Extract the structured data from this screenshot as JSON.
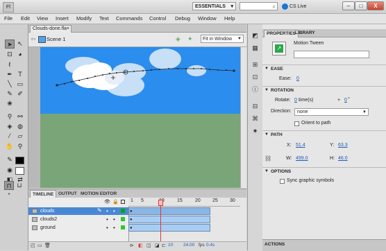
{
  "app": {
    "logo": "Fl"
  },
  "titlebar": {
    "workspace": "ESSENTIALS",
    "cs_live": "CS Live",
    "min": "–",
    "max": "□",
    "close": "X"
  },
  "menu": [
    "File",
    "Edit",
    "View",
    "Insert",
    "Modify",
    "Text",
    "Commands",
    "Control",
    "Debug",
    "Window",
    "Help"
  ],
  "document": {
    "tab": "Clouds-done.fla",
    "close": "×",
    "scene": "Scene 1",
    "zoom": "Fit in Window"
  },
  "timeline": {
    "tabs": [
      "TIMELINE",
      "OUTPUT",
      "MOTION EDITOR"
    ],
    "layers": [
      {
        "name": "clouds",
        "selected": true,
        "color": "#00aa00"
      },
      {
        "name": "clouds2",
        "selected": false,
        "color": "#2ec72e"
      },
      {
        "name": "ground",
        "selected": false,
        "color": "#2ec72e"
      }
    ],
    "ruler": [
      "1",
      "5",
      "10",
      "15",
      "20",
      "25",
      "30"
    ],
    "current_frame": "10",
    "fps": "24.00",
    "fps_unit": "fps",
    "time": "0.4s"
  },
  "properties": {
    "tabs": [
      "PROPERTIES",
      "LIBRARY"
    ],
    "type": "Motion Tween",
    "ease_section": "EASE",
    "ease_label": "Ease:",
    "ease_value": "0",
    "rotation_section": "ROTATION",
    "rotate_label": "Rotate:",
    "rotate_times": "0",
    "rotate_times_unit": "time(s)",
    "rotate_plus": "+",
    "rotate_degrees": "0",
    "rotate_deg_unit": "°",
    "direction_label": "Direction:",
    "direction_value": "none",
    "orient_label": "Orient to path",
    "path_section": "PATH",
    "x_label": "X:",
    "x_value": "51.4",
    "y_label": "Y:",
    "y_value": "63.3",
    "w_label": "W:",
    "w_value": "499.0",
    "h_label": "H:",
    "h_value": "46.0",
    "options_section": "OPTIONS",
    "sync_label": "Sync graphic symbols",
    "actions": "ACTIONS"
  },
  "colors": {
    "sky": "#2b8ded",
    "ground": "#7aa578",
    "accent_blue": "#1e5bb5",
    "selection": "#4b88d4"
  }
}
